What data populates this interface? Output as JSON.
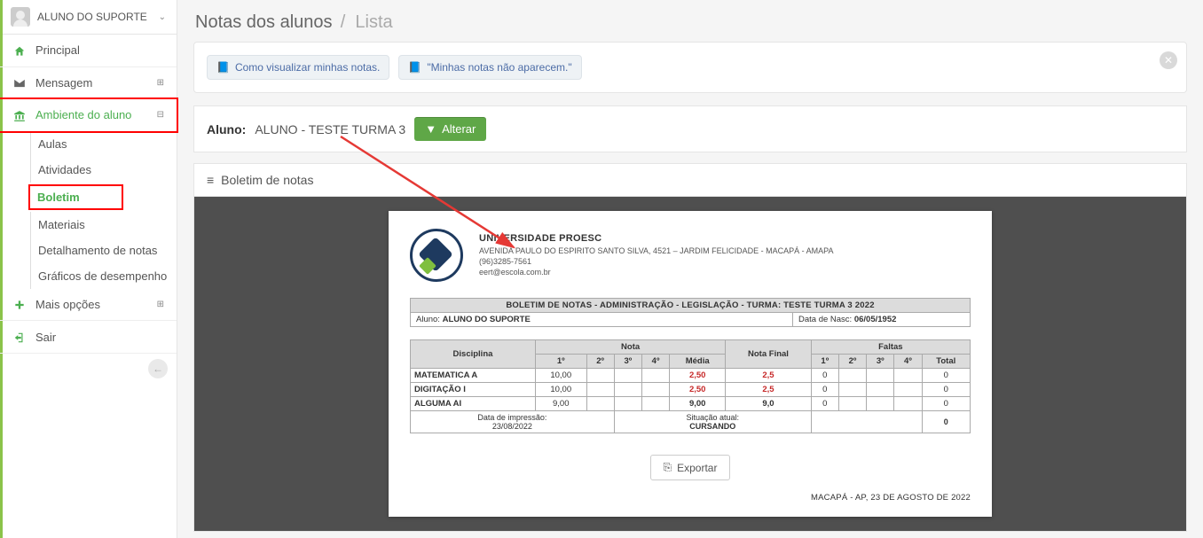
{
  "user": {
    "name": "ALUNO DO SUPORTE"
  },
  "nav": {
    "principal": "Principal",
    "mensagem": "Mensagem",
    "ambiente": "Ambiente do aluno",
    "sub": {
      "aulas": "Aulas",
      "atividades": "Atividades",
      "boletim": "Boletim",
      "materiais": "Materiais",
      "detalhamento": "Detalhamento de notas",
      "graficos": "Gráficos de desempenho"
    },
    "maisopcoes": "Mais opções",
    "sair": "Sair"
  },
  "header": {
    "title": "Notas dos alunos",
    "crumb": "Lista"
  },
  "help": {
    "link1": "Como visualizar minhas notas.",
    "link2": "\"Minhas notas não aparecem.\""
  },
  "alunobar": {
    "label": "Aluno:",
    "value": "ALUNO - TESTE TURMA 3",
    "alterar": "Alterar"
  },
  "panel": {
    "title": "Boletim de notas",
    "exportar": "Exportar"
  },
  "doc": {
    "uni": "UNIVERSIDADE PROESC",
    "addr": "AVENIDA PAULO DO ESPIRITO SANTO SILVA, 4521 – JARDIM FELICIDADE - MACAPÁ - AMAPA",
    "phone": "(96)3285-7561",
    "email": "eert@escola.com.br",
    "bol_title": "BOLETIM DE NOTAS - ADMINISTRAÇÃO - LEGISLAÇÃO - TURMA: TESTE TURMA 3 2022",
    "aluno_label": "Aluno:",
    "aluno_value": "ALUNO DO SUPORTE",
    "nasc_label": "Data de Nasc:",
    "nasc_value": "06/05/1952",
    "cols": {
      "disciplina": "Disciplina",
      "nota": "Nota",
      "notafinal": "Nota Final",
      "faltas": "Faltas",
      "b1": "1º",
      "b2": "2º",
      "b3": "3º",
      "b4": "4º",
      "media": "Média",
      "f1": "1º",
      "f2": "2º",
      "f3": "3º",
      "f4": "4º",
      "ftotal": "Total"
    },
    "rows": [
      {
        "disc": "MATEMATICA A",
        "n1": "10,00",
        "n2": "",
        "n3": "",
        "n4": "",
        "media": "2,50",
        "final": "2,5",
        "f1": "0",
        "f2": "",
        "f3": "",
        "f4": "",
        "ftot": "0"
      },
      {
        "disc": "DIGITAÇÃO I",
        "n1": "10,00",
        "n2": "",
        "n3": "",
        "n4": "",
        "media": "2,50",
        "final": "2,5",
        "f1": "0",
        "f2": "",
        "f3": "",
        "f4": "",
        "ftot": "0"
      },
      {
        "disc": "ALGUMA AI",
        "n1": "9,00",
        "n2": "",
        "n3": "",
        "n4": "",
        "media": "9,00",
        "final": "9,0",
        "f1": "0",
        "f2": "",
        "f3": "",
        "f4": "",
        "ftot": "0"
      }
    ],
    "impr_label": "Data de impressão:",
    "impr_value": "23/08/2022",
    "sit_label": "Situação atual:",
    "sit_value": "CURSANDO",
    "tot_faltas": "0",
    "sign": "MACAPÁ - AP, 23 DE AGOSTO DE 2022"
  }
}
